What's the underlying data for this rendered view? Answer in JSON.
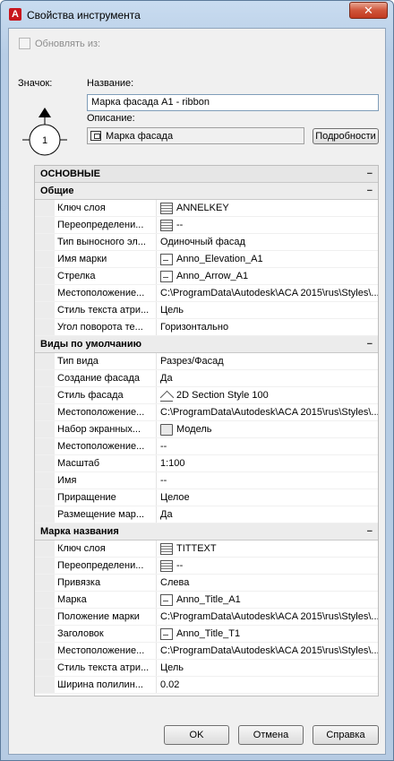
{
  "window": {
    "title": "Свойства инструмента",
    "close_label": "✕"
  },
  "update_from": {
    "label": "Обновлять из:"
  },
  "icon_label": "Значок:",
  "icon_preview_text": "1",
  "name": {
    "label": "Название:",
    "value": "Марка фасада A1 - ribbon"
  },
  "description": {
    "label": "Описание:",
    "value": "Марка фасада",
    "details_button": "Подробности"
  },
  "grid": {
    "section_title": "ОСНОВНЫЕ",
    "categories": [
      {
        "title": "Общие",
        "rows": [
          {
            "name": "Ключ слоя",
            "value": "ANNELKEY",
            "icon": "layer-icon"
          },
          {
            "name": "Переопределени...",
            "value": "--",
            "icon": "layer-icon"
          },
          {
            "name": "Тип выносного эл...",
            "value": "Одиночный фасад",
            "icon": ""
          },
          {
            "name": "Имя марки",
            "value": "Anno_Elevation_A1",
            "icon": "tag-icon"
          },
          {
            "name": "Стрелка",
            "value": "Anno_Arrow_A1",
            "icon": "tag-icon"
          },
          {
            "name": "Местоположение...",
            "value": "C:\\ProgramData\\Autodesk\\ACA 2015\\rus\\Styles\\...",
            "icon": ""
          },
          {
            "name": "Стиль текста атри...",
            "value": "Цель",
            "icon": ""
          },
          {
            "name": "Угол поворота те...",
            "value": "Горизонтально",
            "icon": ""
          }
        ]
      },
      {
        "title": "Виды по умолчанию",
        "rows": [
          {
            "name": "Тип вида",
            "value": "Разрез/Фасад",
            "icon": ""
          },
          {
            "name": "Создание фасада",
            "value": "Да",
            "icon": ""
          },
          {
            "name": "Стиль фасада",
            "value": "2D Section Style 100",
            "icon": "facade-icon"
          },
          {
            "name": "Местоположение...",
            "value": "C:\\ProgramData\\Autodesk\\ACA 2015\\rus\\Styles\\...",
            "icon": ""
          },
          {
            "name": "Набор экранных...",
            "value": "Модель",
            "icon": "display-set-icon"
          },
          {
            "name": "Местоположение...",
            "value": "--",
            "icon": ""
          },
          {
            "name": "Масштаб",
            "value": "1:100",
            "icon": ""
          },
          {
            "name": "Имя",
            "value": "--",
            "icon": ""
          },
          {
            "name": "Приращение",
            "value": "Целое",
            "icon": ""
          },
          {
            "name": "Размещение мар...",
            "value": "Да",
            "icon": ""
          }
        ]
      },
      {
        "title": "Марка названия",
        "rows": [
          {
            "name": "Ключ слоя",
            "value": "TITTEXT",
            "icon": "layer-icon"
          },
          {
            "name": "Переопределени...",
            "value": "--",
            "icon": "layer-icon"
          },
          {
            "name": "Привязка",
            "value": "Слева",
            "icon": ""
          },
          {
            "name": "Марка",
            "value": "Anno_Title_A1",
            "icon": "tag-icon"
          },
          {
            "name": "Положение марки",
            "value": "C:\\ProgramData\\Autodesk\\ACA 2015\\rus\\Styles\\...",
            "icon": ""
          },
          {
            "name": "Заголовок",
            "value": "Anno_Title_T1",
            "icon": "tag-icon"
          },
          {
            "name": "Местоположение...",
            "value": "C:\\ProgramData\\Autodesk\\ACA 2015\\rus\\Styles\\...",
            "icon": ""
          },
          {
            "name": "Стиль текста атри...",
            "value": "Цель",
            "icon": ""
          },
          {
            "name": "Ширина полилин...",
            "value": "0.02",
            "icon": ""
          }
        ]
      }
    ]
  },
  "buttons": {
    "ok": "OK",
    "cancel": "Отмена",
    "help": "Справка"
  }
}
